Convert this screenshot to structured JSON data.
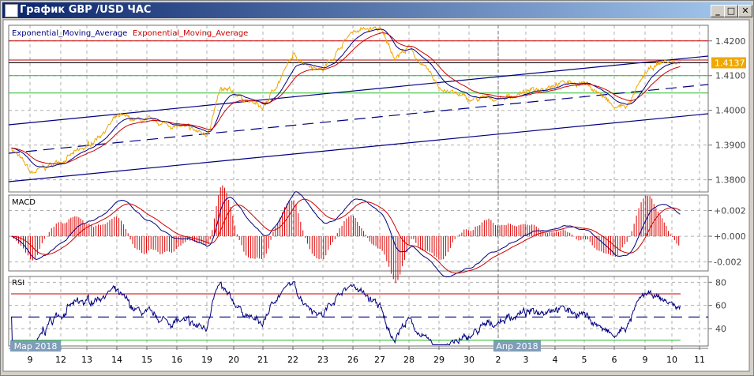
{
  "window": {
    "title": "График GBP /USD  ЧАС",
    "minimize_icon": "minimize-icon",
    "maximize_icon": "maximize-icon",
    "close_icon": "close-icon"
  },
  "legend": {
    "ema_fast": "Exponential_Moving_Average",
    "ema_slow": "Exponential_Moving_Average"
  },
  "colors": {
    "price": "#f0a800",
    "ema_fast": "#000080",
    "ema_slow": "#cc0000",
    "grid": "#b0b0b0",
    "level_red": "#cc0000",
    "level_green": "#22bb22",
    "channel": "#000080",
    "rsi_overbought": "#e020e0",
    "current_price_bg": "#f0a800"
  },
  "price_axis": {
    "labels": [
      "1.4200",
      "1.4100",
      "1.4000",
      "1.3900",
      "1.3800"
    ],
    "current_price": "1.4137"
  },
  "macd": {
    "title": "MACD",
    "labels": [
      "+0.002",
      "+0.000",
      "-0.002"
    ]
  },
  "rsi": {
    "title": "RSI",
    "labels": [
      "80",
      "60",
      "40"
    ]
  },
  "time_axis": {
    "labels": [
      "9",
      "12",
      "13",
      "14",
      "15",
      "16",
      "19",
      "20",
      "21",
      "22",
      "23",
      "26",
      "27",
      "28",
      "29",
      "30",
      "2",
      "3",
      "4",
      "5",
      "6",
      "9",
      "10",
      "11"
    ],
    "month_start": "Мар 2018",
    "month_apr": "Апр 2018"
  },
  "chart_data": {
    "type": "line",
    "title": "График GBP /USD  ЧАС",
    "x_unit": "trading day tick index (0 = Mar 9)",
    "price_keypoints": [
      [
        -0.6,
        1.3893
      ],
      [
        0.05,
        1.3817
      ],
      [
        1,
        1.3855
      ],
      [
        2,
        1.3893
      ],
      [
        3,
        1.398
      ],
      [
        4,
        1.3968
      ],
      [
        5,
        1.3955
      ],
      [
        6,
        1.393
      ],
      [
        6.5,
        1.4055
      ],
      [
        7,
        1.405
      ],
      [
        8,
        1.4005
      ],
      [
        9,
        1.4155
      ],
      [
        10,
        1.4118
      ],
      [
        11,
        1.423
      ],
      [
        12,
        1.4235
      ],
      [
        12.5,
        1.4155
      ],
      [
        13,
        1.418
      ],
      [
        14,
        1.4068
      ],
      [
        15,
        1.403
      ],
      [
        16,
        1.4035
      ],
      [
        17,
        1.405
      ],
      [
        18,
        1.408
      ],
      [
        19,
        1.408
      ],
      [
        19.5,
        1.405
      ],
      [
        20,
        1.4005
      ],
      [
        20.5,
        1.4018
      ],
      [
        21,
        1.4105
      ],
      [
        21.7,
        1.4142
      ],
      [
        22.3,
        1.4137
      ]
    ],
    "price_ylim": [
      1.3765,
      1.4245
    ],
    "levels": {
      "red": [
        1.42,
        1.4145
      ],
      "black": [
        1.4137
      ],
      "green": [
        1.41,
        1.405
      ]
    },
    "macd_ylim": [
      -0.0027,
      0.0032
    ],
    "rsi_ylim": [
      25,
      85
    ],
    "rsi_levels": {
      "overbought": 70,
      "mid": 50,
      "oversold": 30
    }
  }
}
